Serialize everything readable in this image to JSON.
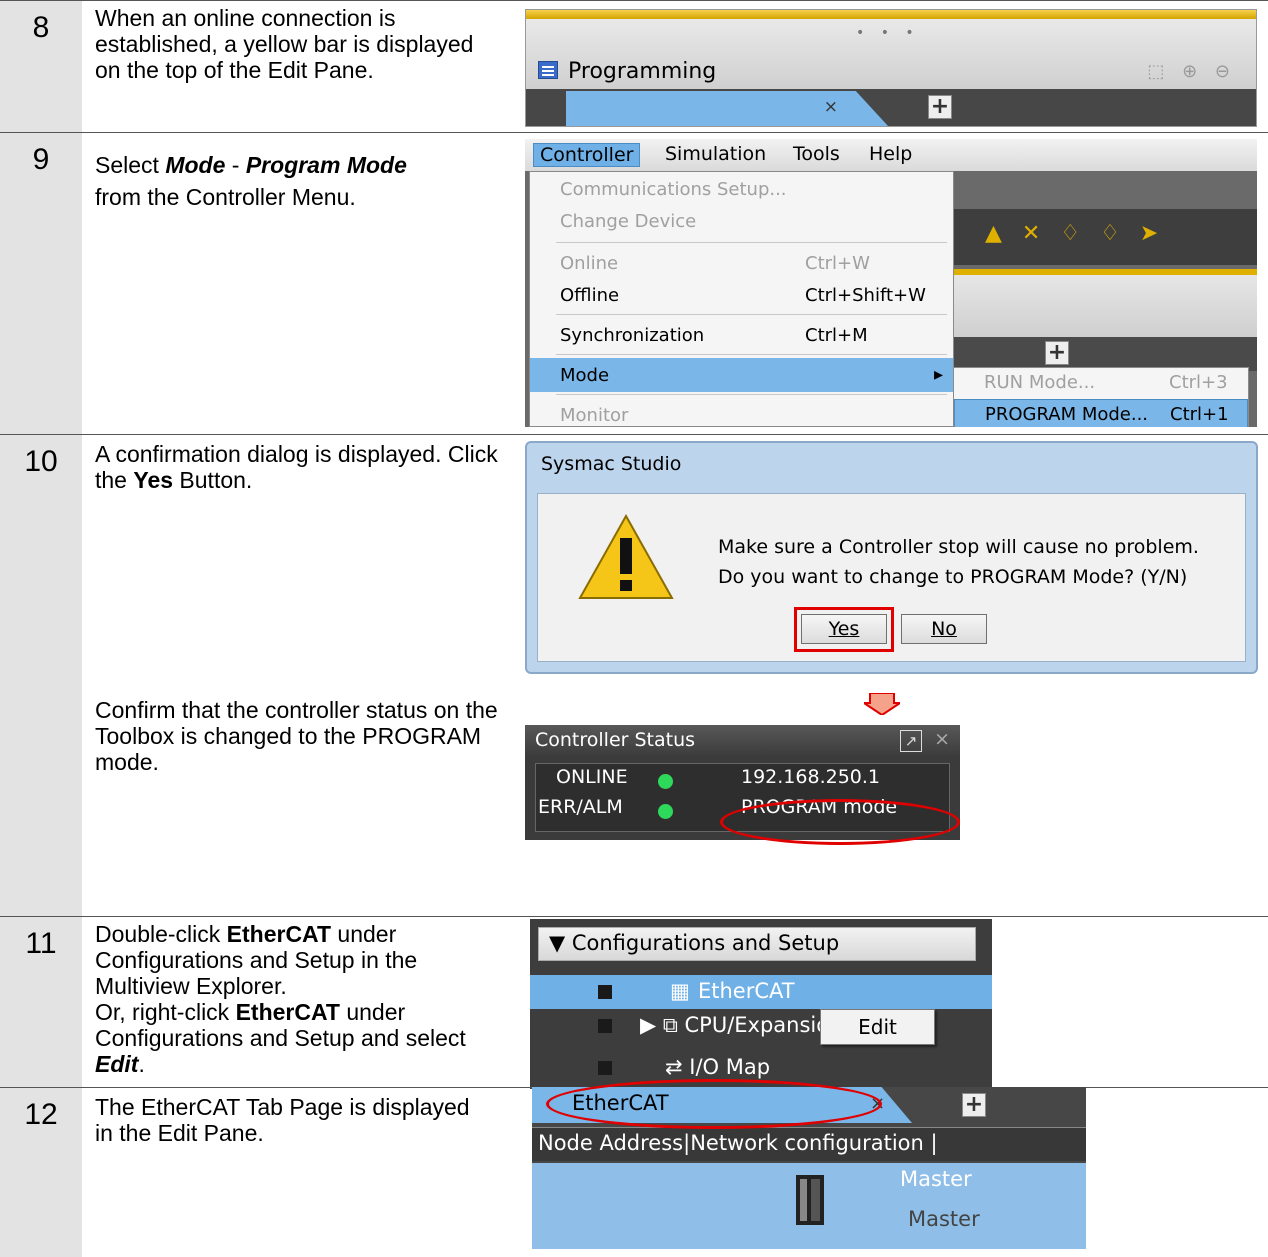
{
  "step8": {
    "num": "8",
    "text": "When an online connection is established, a yellow bar is displayed on the top of the Edit Pane.",
    "pane_label": "Programming",
    "tab_close": "×",
    "plus": "+"
  },
  "step9": {
    "num": "9",
    "text_a": "Select ",
    "mode": "Mode",
    "dash": " - ",
    "program_mode": "Program Mode",
    "text_b": "from the Controller Menu.",
    "menubar": [
      "Controller",
      "Simulation",
      "Tools",
      "Help"
    ],
    "menu": [
      {
        "label": "Communications Setup...",
        "shortcut": "",
        "disabled": true
      },
      {
        "label": "Change Device",
        "shortcut": "",
        "disabled": true
      },
      {
        "label": "Online",
        "shortcut": "Ctrl+W",
        "disabled": true
      },
      {
        "label": "Offline",
        "shortcut": "Ctrl+Shift+W",
        "disabled": false
      },
      {
        "label": "Synchronization",
        "shortcut": "Ctrl+M",
        "disabled": false
      },
      {
        "label": "Mode",
        "shortcut": "",
        "disabled": false
      },
      {
        "label": "Monitor",
        "shortcut": "",
        "disabled": true
      }
    ],
    "submenu": [
      {
        "label": "RUN Mode...",
        "shortcut": "Ctrl+3"
      },
      {
        "label": "PROGRAM Mode...",
        "shortcut": "Ctrl+1"
      }
    ],
    "submenu_arrow": "▸"
  },
  "step10": {
    "num": "10",
    "text_a": "A confirmation dialog is displayed. Click the ",
    "yes_word": "Yes",
    "text_b": " Button.",
    "dialog_title": "Sysmac Studio",
    "msg1": "Make sure a Controller stop will cause no problem.",
    "msg2": "Do you want to change to PROGRAM Mode? (Y/N)",
    "yes": "Yes",
    "no": "No",
    "confirm_text": "Confirm that the controller status on the Toolbox is changed to the PROGRAM mode.",
    "cs_title": "Controller Status",
    "cs_close": "×",
    "online": "ONLINE",
    "err": "ERR/ALM",
    "ip": "192.168.250.1",
    "mode_status": "PROGRAM mode",
    "status_color": "#2ed85a"
  },
  "step11": {
    "num": "11",
    "t1": "Double-click ",
    "ethercat": "EtherCAT",
    "t2": " under Configurations and Setup in the Multiview Explorer.",
    "t3": "Or, right-click ",
    "t4": " under Configurations and Setup and select ",
    "edit": "Edit",
    "t5": ".",
    "header": "▼ Configurations and Setup",
    "items": [
      "EtherCAT",
      "▶ ⧉ CPU/Expansion Racks",
      "⇄ I/O Map"
    ],
    "ctx_edit": "Edit"
  },
  "step12": {
    "num": "12",
    "text": "The EtherCAT Tab Page is displayed in the Edit Pane.",
    "tab": "EtherCAT",
    "tab_close": "×",
    "plus": "+",
    "header": "Node Address|Network configuration   |",
    "master1": "Master",
    "master2": "Master"
  },
  "colors": {
    "accent_blue": "#7ab6e8",
    "highlight_red": "#e00000",
    "online_yellow": "#e0b000"
  }
}
